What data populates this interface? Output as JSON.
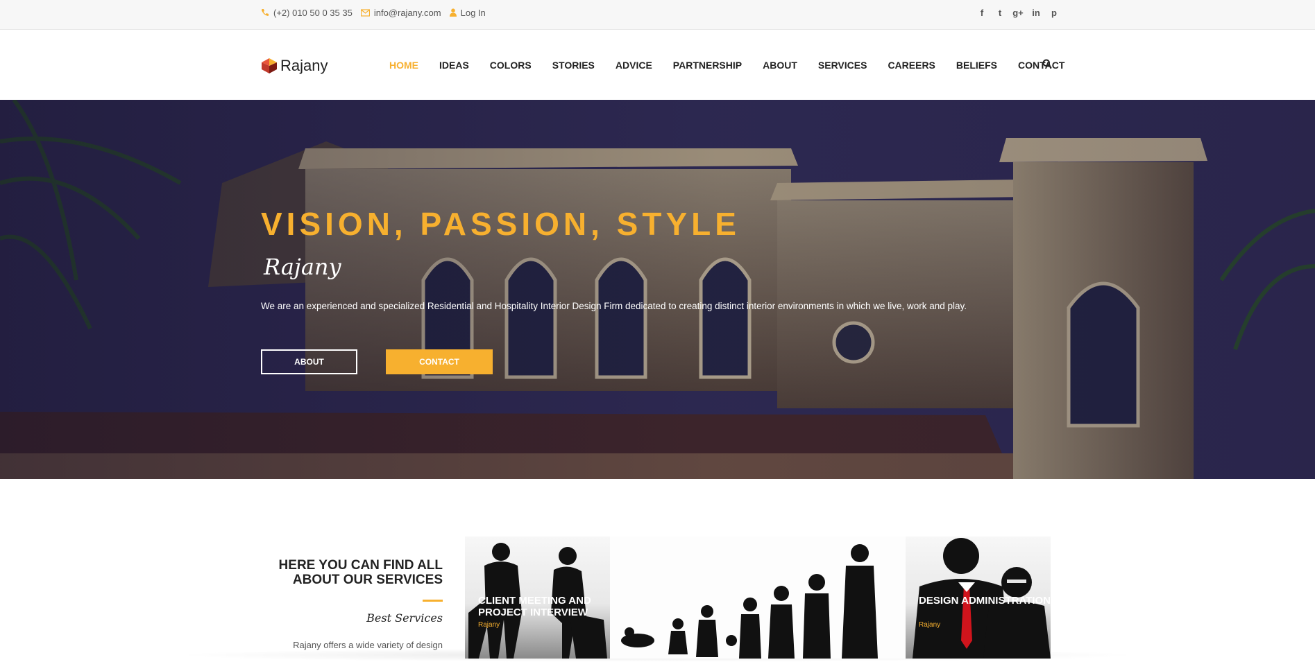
{
  "topbar": {
    "phone": "(+2) 010 50 0 35 35",
    "email": "info@rajany.com",
    "login": "Log In",
    "social": [
      {
        "icon": "facebook-icon",
        "glyph": "f"
      },
      {
        "icon": "twitter-icon",
        "glyph": "t"
      },
      {
        "icon": "google-plus-icon",
        "glyph": "g+"
      },
      {
        "icon": "linkedin-icon",
        "glyph": "in"
      },
      {
        "icon": "pinterest-icon",
        "glyph": "p"
      }
    ]
  },
  "header": {
    "logo_text": "Rajany",
    "nav": [
      "HOME",
      "IDEAS",
      "COLORS",
      "STORIES",
      "ADVICE",
      "PARTNERSHIP",
      "ABOUT",
      "SERVICES",
      "CAREERS",
      "BELIEFS",
      "CONTACT"
    ],
    "active": "HOME"
  },
  "hero": {
    "title": "VISION, PASSION, STYLE",
    "script": "Rajany",
    "description": "We are an experienced and specialized Residential and Hospitality Interior Design Firm dedicated to creating distinct interior environments in which we live, work and play.",
    "about_button": "ABOUT",
    "contact_button": "CONTACT"
  },
  "services": {
    "heading": "HERE YOU CAN FIND ALL ABOUT OUR SERVICES",
    "subheading": "Best Services",
    "paragraph": "Rajany offers a wide variety of design",
    "cards": [
      {
        "label": "CLIENT MEETING AND PROJECT INTERVIEW",
        "tag": "Rajany"
      },
      {
        "label": "",
        "tag": ""
      },
      {
        "label": "DESIGN ADMINISTRATION",
        "tag": "Rajany"
      }
    ]
  },
  "colors": {
    "accent": "#f7b02f",
    "hero_sky": "#2f2b5a",
    "text": "#222222"
  }
}
